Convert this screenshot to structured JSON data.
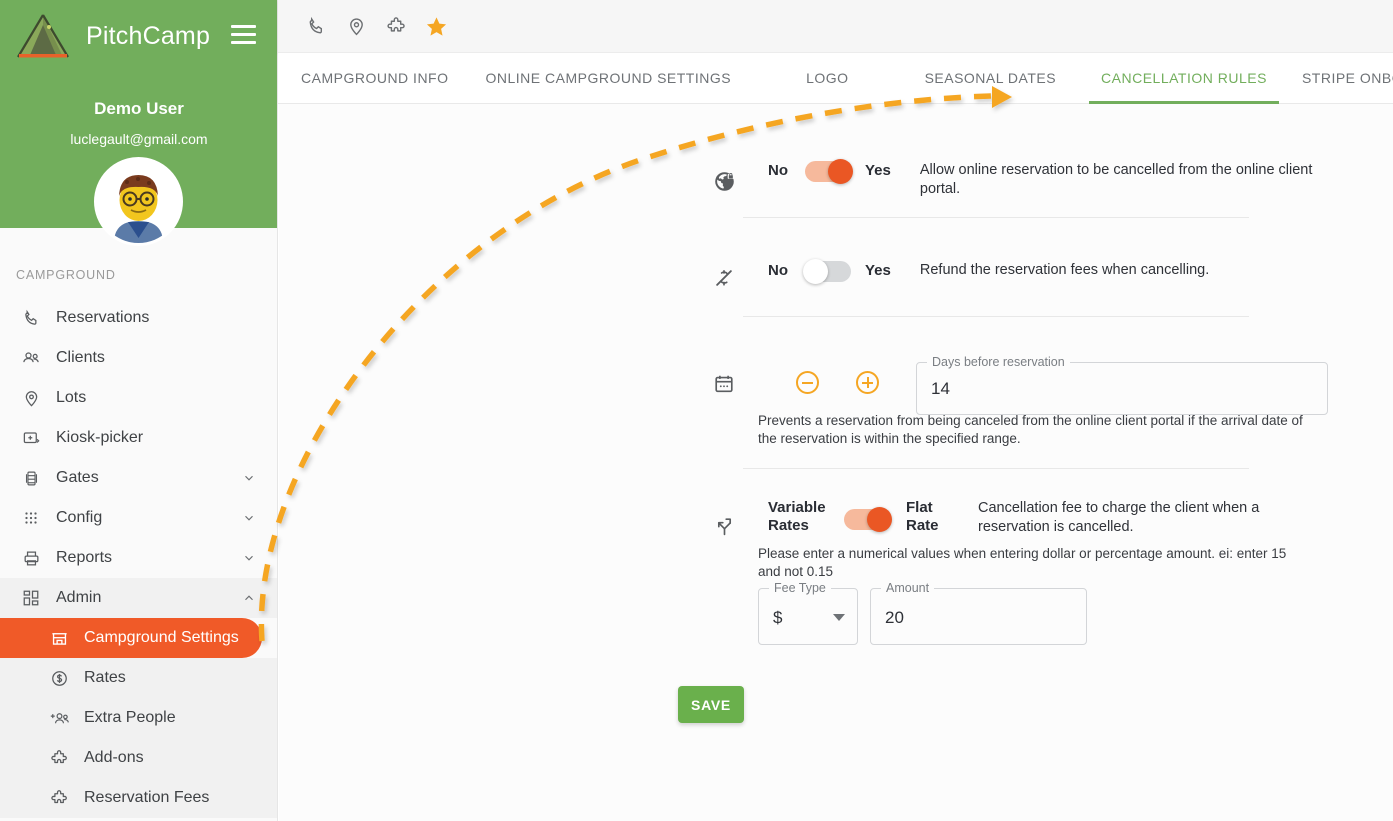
{
  "brand": {
    "title": "PitchCamp",
    "logo_icon": "tent-icon",
    "menu_icon": "hamburger-menu-icon"
  },
  "user": {
    "name": "Demo User",
    "email": "luclegault@gmail.com",
    "avatar_icon": "user-avatar"
  },
  "sidebar": {
    "section_label": "CAMPGROUND",
    "items": [
      {
        "label": "Reservations",
        "icon": "phone-icon",
        "expandable": false
      },
      {
        "label": "Clients",
        "icon": "people-icon",
        "expandable": false
      },
      {
        "label": "Lots",
        "icon": "map-pin-icon",
        "expandable": false
      },
      {
        "label": "Kiosk-picker",
        "icon": "kiosk-icon",
        "expandable": false
      },
      {
        "label": "Gates",
        "icon": "gate-icon",
        "expandable": true
      },
      {
        "label": "Config",
        "icon": "grid-dots-icon",
        "expandable": true
      },
      {
        "label": "Reports",
        "icon": "printer-icon",
        "expandable": true
      },
      {
        "label": "Admin",
        "icon": "dashboard-icon",
        "expandable": true,
        "expanded": true
      }
    ],
    "admin_subitems": [
      {
        "label": "Campground Settings",
        "icon": "store-icon",
        "active": true
      },
      {
        "label": "Rates",
        "icon": "dollar-circle-icon",
        "active": false
      },
      {
        "label": "Extra People",
        "icon": "add-people-icon",
        "active": false
      },
      {
        "label": "Add-ons",
        "icon": "puzzle-icon",
        "active": false
      },
      {
        "label": "Reservation Fees",
        "icon": "puzzle-icon",
        "active": false
      }
    ]
  },
  "topbar": {
    "icons": [
      {
        "name": "phone-icon",
        "active": false
      },
      {
        "name": "map-pin-icon",
        "active": false
      },
      {
        "name": "puzzle-icon",
        "active": false
      },
      {
        "name": "star-icon",
        "active": true
      }
    ]
  },
  "tabs": [
    {
      "label": "CAMPGROUND INFO",
      "active": false
    },
    {
      "label": "ONLINE CAMPGROUND SETTINGS",
      "active": false
    },
    {
      "label": "LOGO",
      "active": false
    },
    {
      "label": "SEASONAL DATES",
      "active": false
    },
    {
      "label": "CANCELLATION RULES",
      "active": true
    },
    {
      "label": "STRIPE ONBOARDING",
      "active": false
    }
  ],
  "settings": {
    "allow_cancel": {
      "icon": "globe-lock-icon",
      "off_label": "No",
      "on_label": "Yes",
      "state": "on",
      "description": "Allow online reservation to be cancelled from the online client portal."
    },
    "refund_fees": {
      "icon": "money-off-icon",
      "off_label": "No",
      "on_label": "Yes",
      "state": "off",
      "description": "Refund the reservation fees when cancelling."
    },
    "days_before": {
      "icon": "calendar-icon",
      "decrement_label": "minus-circle-icon",
      "increment_label": "plus-circle-icon",
      "field_label": "Days before reservation",
      "field_value": "14",
      "description": "Prevents a reservation from being canceled from the online client portal if the arrival date of the reservation is within the specified range."
    },
    "fee_mode": {
      "icon": "split-arrows-icon",
      "off_label": "Variable Rates",
      "on_label": "Flat Rate",
      "state": "on",
      "description": "Cancellation fee to charge the client when a reservation is cancelled.",
      "hint": "Please enter a numerical values when entering dollar or percentage amount. ei: enter 15 and not 0.15",
      "fee_type_label": "Fee Type",
      "fee_type_value": "$",
      "amount_label": "Amount",
      "amount_value": "20"
    }
  },
  "actions": {
    "save_label": "SAVE"
  },
  "annotation": {
    "arrow_icon": "dashed-curved-arrow",
    "arrow_color": "#f5a623"
  },
  "colors": {
    "green": "#72ae5c",
    "orange": "#f05a28",
    "toggle_on": "#ea5724",
    "toggle_track": "#f6b99c",
    "save_green": "#6ab04c",
    "accent_amber": "#f5a623"
  }
}
